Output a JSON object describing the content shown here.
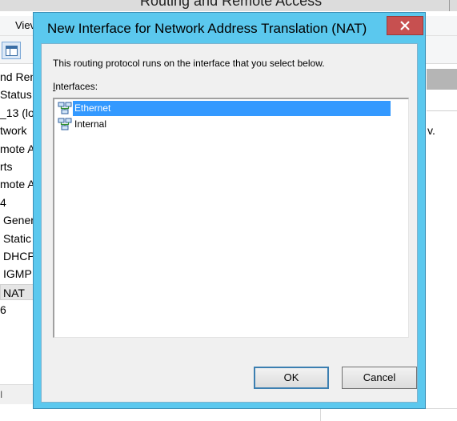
{
  "background": {
    "window_title": "Routing and Remote Access",
    "menu_view": "Viev",
    "tree_items": [
      {
        "label": "nd Ren",
        "indent": 0,
        "selected": false
      },
      {
        "label": "Status",
        "indent": 0,
        "selected": false
      },
      {
        "label": "_13 (lo",
        "indent": 0,
        "selected": false
      },
      {
        "label": "twork",
        "indent": 0,
        "selected": false
      },
      {
        "label": "mote A",
        "indent": 0,
        "selected": false
      },
      {
        "label": "rts",
        "indent": 0,
        "selected": false
      },
      {
        "label": "mote A",
        "indent": 0,
        "selected": false
      },
      {
        "label": "4",
        "indent": 0,
        "selected": false
      },
      {
        "label": "Gener",
        "indent": 1,
        "selected": false
      },
      {
        "label": "Static",
        "indent": 1,
        "selected": false
      },
      {
        "label": "DHCP",
        "indent": 1,
        "selected": false
      },
      {
        "label": "IGMP",
        "indent": 1,
        "selected": false
      },
      {
        "label": "NAT",
        "indent": 1,
        "selected": true
      },
      {
        "label": "6",
        "indent": 0,
        "selected": false
      }
    ],
    "hscroll_text": "I",
    "right_text": "v."
  },
  "dialog": {
    "title": "New Interface for Network Address Translation (NAT)",
    "close_glyph": "X",
    "description": "This routing protocol runs on the interface that you select below.",
    "interfaces_label_accel": "I",
    "interfaces_label_rest": "nterfaces:",
    "interfaces": [
      {
        "name": "Ethernet",
        "selected": true,
        "icon": "network-interface-icon"
      },
      {
        "name": "Internal",
        "selected": false,
        "icon": "network-interface-icon"
      }
    ],
    "ok_label": "OK",
    "cancel_label": "Cancel"
  }
}
